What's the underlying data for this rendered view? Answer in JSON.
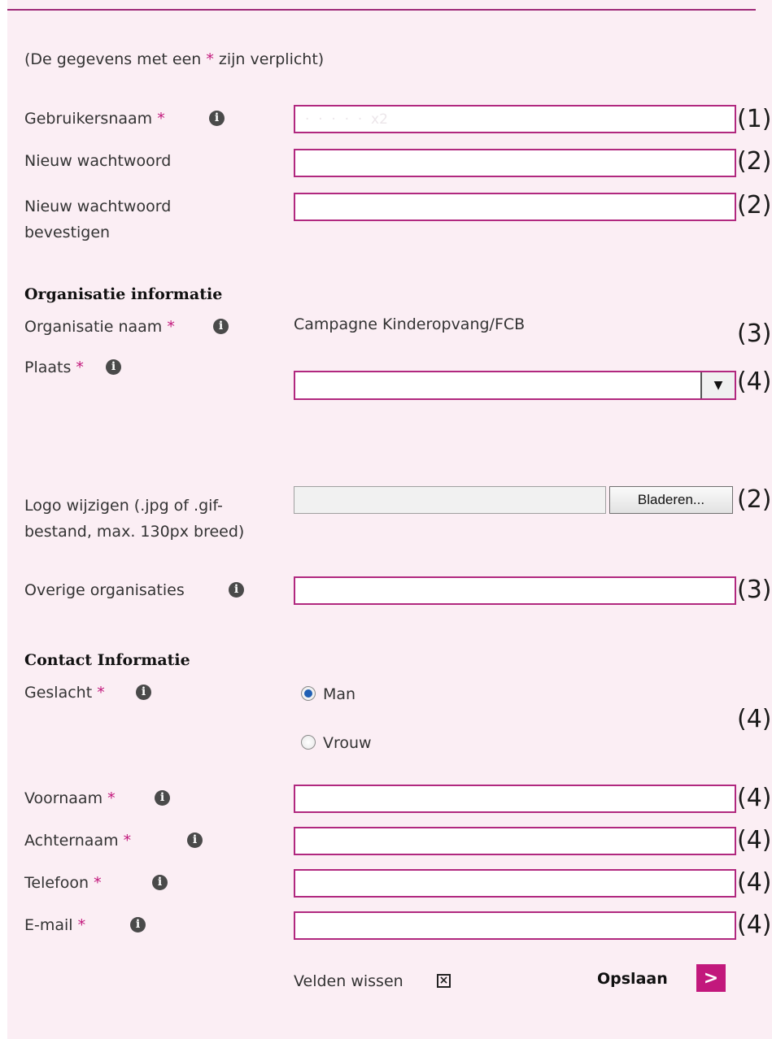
{
  "notice": {
    "prefix": "(De gegevens met een ",
    "star": "*",
    "suffix": " zijn verplicht)"
  },
  "required_mark": "*",
  "info_icon_glyph": "i",
  "account": {
    "username": {
      "label": "Gebruikersnaam",
      "value": "·  ·  ·  ·  ·  x2",
      "note": "(1)"
    },
    "new_password": {
      "label": "Nieuw wachtwoord",
      "value": "",
      "note": "(2)"
    },
    "confirm_password": {
      "label": "Nieuw wachtwoord bevestigen",
      "value": "",
      "note": "(2)"
    }
  },
  "organisation": {
    "heading": "Organisatie informatie",
    "name": {
      "label": "Organisatie naam",
      "value": "Campagne Kinderopvang/FCB",
      "note": "(3)"
    },
    "place": {
      "label": "Plaats",
      "value": "",
      "note": "(4)",
      "arrow": "▼"
    },
    "logo": {
      "label": "Logo wijzigen (.jpg of .gif-bestand, max. 130px breed)",
      "button": "Bladeren...",
      "note": "(2)"
    },
    "other": {
      "label": "Overige organisaties",
      "value": "",
      "note": "(3)"
    }
  },
  "contact": {
    "heading": "Contact Informatie",
    "gender": {
      "label": "Geslacht",
      "options": [
        "Man",
        "Vrouw"
      ],
      "selected": "Man",
      "note": "(4)"
    },
    "first_name": {
      "label": "Voornaam",
      "value": "",
      "note": "(4)"
    },
    "last_name": {
      "label": "Achternaam",
      "value": "",
      "note": "(4)"
    },
    "phone": {
      "label": "Telefoon",
      "value": "",
      "note": "(4)"
    },
    "email": {
      "label": "E-mail",
      "value": "",
      "note": "(4)"
    }
  },
  "actions": {
    "clear_label": "Velden wissen",
    "clear_glyph": "×",
    "save_label": "Opslaan",
    "save_glyph": ">"
  },
  "colors": {
    "panel_background": "#fbeef4",
    "accent": "#b1287f",
    "required": "#c2187c"
  }
}
